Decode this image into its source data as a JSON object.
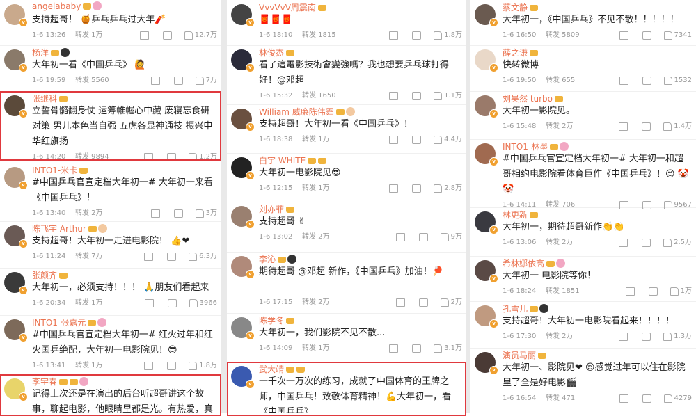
{
  "columns": [
    {
      "id": "col1",
      "items": [
        {
          "name": "angelababy",
          "badges": [
            "crown",
            "pink"
          ],
          "text": "支持超哥！ 🍯乒乓乒乓过大年🧨",
          "time": "1-6 13:26",
          "repost": "转发 1万",
          "likes": "12.7万"
        },
        {
          "name": "杨洋",
          "badges": [
            "crown",
            "panda"
          ],
          "text": "大年初一看《中国乒乓》 🙋",
          "time": "1-6 19:59",
          "repost": "转发 5560",
          "likes": "7万"
        },
        {
          "name": "张继科",
          "badges": [
            "crown"
          ],
          "text": "立誓骨髓翻身仗 运筹帷幄心中藏 废寝忘食研对策 男儿本色当自强 五虎各显神通技 振兴中华红旗扬",
          "time": "1-6 14:20",
          "repost": "转发 9894",
          "likes": "1.2万"
        },
        {
          "name": "INTO1-米卡",
          "badges": [
            "crown"
          ],
          "text": "#中国乒乓官宣定档大年初一# 大年初一来看《中国乒乓》！",
          "time": "1-6 13:40",
          "repost": "转发 2万",
          "likes": "3万"
        },
        {
          "name": "陈飞宇 Arthur",
          "badges": [
            "crown",
            "silver"
          ],
          "text": "支持超哥！大年初一走进电影院！ 👍❤",
          "time": "1-6 11:24",
          "repost": "转发 7万",
          "likes": "6.3万"
        },
        {
          "name": "张颜齐",
          "badges": [
            "crown"
          ],
          "text": "大年初一，必须支持！！！ 🙏朋友们看起来",
          "time": "1-6 20:34",
          "repost": "转发 1万",
          "likes": "3966"
        },
        {
          "name": "INTO1-张嘉元",
          "badges": [
            "crown",
            "pink"
          ],
          "text": "#中国乒乓官宣定档大年初一# 红火过年和红火国乒绝配，大年初一电影院见！😎",
          "time": "1-6 13:41",
          "repost": "转发 1万",
          "likes": "1.8万"
        },
        {
          "name": "李宇春",
          "badges": [
            "crown",
            "crown",
            "pink"
          ],
          "text": "记得上次还是在演出的后台听超哥讲这个故事，聊起电影，他眼睛里都是光。有热爱，真",
          "time": "",
          "repost": "",
          "likes": ""
        }
      ]
    },
    {
      "id": "col2",
      "items": [
        {
          "name": "VvvVvV周震南",
          "badges": [
            "crown"
          ],
          "text": "🧧🧧🧧",
          "time": "1-6 18:10",
          "repost": "转发 1815",
          "likes": "1.8万"
        },
        {
          "name": "林俊杰",
          "badges": [
            "crown"
          ],
          "text": "看了這電影技術會變強嗎？我也想要乒乓球打得好！@邓超",
          "time": "1-6 15:32",
          "repost": "转发 1650",
          "likes": "1.1万"
        },
        {
          "name": "William 威廉陈伟霆",
          "badges": [
            "crown",
            "silver"
          ],
          "text": "支持超哥！大年初一看《中国乒乓》！",
          "time": "1-6 18:38",
          "repost": "转发 1万",
          "likes": "4.4万"
        },
        {
          "name": "白宇 WHITE",
          "badges": [
            "crown",
            "crown"
          ],
          "text": "大年初一电影院见😎",
          "time": "1-6 12:15",
          "repost": "转发 1万",
          "likes": "2.8万"
        },
        {
          "name": "刘亦菲",
          "badges": [
            "crown"
          ],
          "text": "支持超哥 ✌",
          "time": "1-6 13:02",
          "repost": "转发 2万",
          "likes": "9万"
        },
        {
          "name": "李沁",
          "badges": [
            "crown",
            "panda"
          ],
          "text": "期待超哥 @邓超 新作，《中国乒乓》加油！🏓",
          "time": "1-6 17:15",
          "repost": "转发 2万",
          "likes": "2万"
        },
        {
          "name": "陈学冬",
          "badges": [
            "crown"
          ],
          "text": "大年初一，我们影院不见不散...",
          "time": "1-6 14:09",
          "repost": "转发 1万",
          "likes": "3.1万"
        },
        {
          "name": "武大靖",
          "badges": [
            "crown",
            "crown"
          ],
          "text": "一千次一万次的练习，成就了中国体育的王牌之师，中国乒乓！致敬体育精神！💪大年初一，看《中国乒乓》",
          "time": "",
          "repost": "",
          "likes": ""
        }
      ]
    },
    {
      "id": "col3",
      "items": [
        {
          "name": "蔡文静",
          "badges": [
            "crown"
          ],
          "text": "大年初一，《中国乒乓》不见不散！！！！！",
          "time": "1-6 16:50",
          "repost": "转发 5809",
          "likes": "7341"
        },
        {
          "name": "薛之谦",
          "badges": [
            "crown"
          ],
          "text": "快转微博",
          "time": "1-6 19:50",
          "repost": "转发 655",
          "likes": "1532"
        },
        {
          "name": "刘昊然 turbo",
          "badges": [
            "crown"
          ],
          "text": "大年初一影院见。",
          "time": "1-6 15:48",
          "repost": "转发 2万",
          "likes": "1.4万"
        },
        {
          "name": "INTO1-林墨",
          "badges": [
            "crown",
            "pink"
          ],
          "text": "#中国乒乓官宣定档大年初一# 大年初一和超哥相约电影院看体育巨作《中国乒乓》！😉 🤡🤡",
          "time": "1-6 14:11",
          "repost": "转发 706",
          "likes": "9567"
        },
        {
          "name": "林更新",
          "badges": [
            "crown"
          ],
          "text": "大年初一，期待超哥新作👏👏",
          "time": "1-6 13:06",
          "repost": "转发 2万",
          "likes": "2.5万"
        },
        {
          "name": "希林娜依高",
          "badges": [
            "crown",
            "pink"
          ],
          "text": "大年初一 电影院等你！",
          "time": "1-6 18:24",
          "repost": "转发 1851",
          "likes": "1万"
        },
        {
          "name": "孔雪儿",
          "badges": [
            "crown",
            "panda"
          ],
          "text": "支持超哥！大年初一电影院看起来！！！！",
          "time": "1-6 17:30",
          "repost": "转发 2万",
          "likes": "1.3万"
        },
        {
          "name": "演员马丽",
          "badges": [
            "crown"
          ],
          "text": "大年初一、影院见❤ 😌感觉过年可以住在影院里了全是好电影🎬",
          "time": "1-6 16:54",
          "repost": "转发 471",
          "likes": "4279"
        }
      ]
    }
  ]
}
